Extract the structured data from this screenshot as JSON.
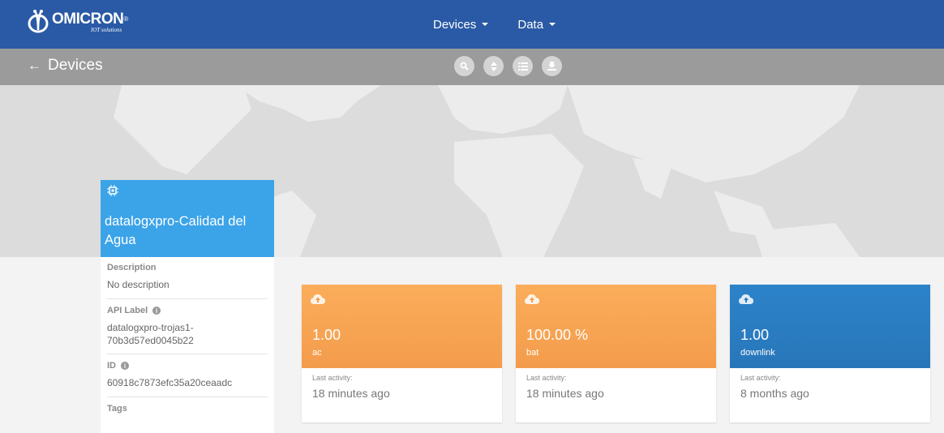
{
  "navbar": {
    "logo_name": "OMICRON",
    "logo_reg": "®",
    "logo_sub": "IOT solutions",
    "menu": [
      {
        "label": "Devices"
      },
      {
        "label": "Data"
      }
    ],
    "color": "#2a5aa5"
  },
  "subbar": {
    "back_label": "Devices",
    "tools": [
      "search-icon",
      "sort-icon",
      "list-icon",
      "download-icon"
    ]
  },
  "device": {
    "name": "datalogxpro-Calidad del Agua",
    "header_color": "#3ba3e8",
    "description_label": "Description",
    "description_value": "No description",
    "api_label_label": "API Label",
    "api_label_value": "datalogxpro-trojas1-70b3d57ed0045b22",
    "id_label": "ID",
    "id_value": "60918c7873efc35a20ceaadc",
    "tags_label": "Tags"
  },
  "variables": [
    {
      "value": "1.00",
      "name": "ac",
      "activity_label": "Last activity:",
      "activity": "18 minutes ago",
      "color": "orange"
    },
    {
      "value": "100.00 %",
      "name": "bat",
      "activity_label": "Last activity:",
      "activity": "18 minutes ago",
      "color": "orange"
    },
    {
      "value": "1.00",
      "name": "downlink",
      "activity_label": "Last activity:",
      "activity": "8 months ago",
      "color": "blue"
    }
  ]
}
